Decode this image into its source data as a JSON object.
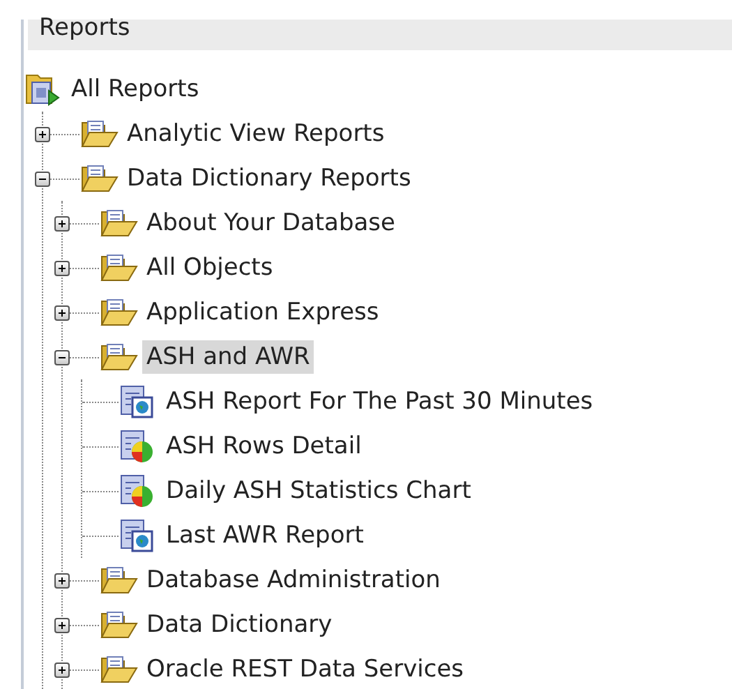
{
  "panel": {
    "title": "Reports"
  },
  "tree": [
    {
      "label": "All Reports",
      "kind": "root",
      "selected": false,
      "children": [
        {
          "label": "Analytic View Reports",
          "kind": "folder",
          "selected": false,
          "expanded": false
        },
        {
          "label": "Data Dictionary Reports",
          "kind": "folder",
          "selected": false,
          "expanded": true,
          "children": [
            {
              "label": "About Your Database",
              "kind": "folder",
              "selected": false,
              "expanded": false
            },
            {
              "label": "All Objects",
              "kind": "folder",
              "selected": false,
              "expanded": false
            },
            {
              "label": "Application Express",
              "kind": "folder",
              "selected": false,
              "expanded": false
            },
            {
              "label": "ASH and AWR",
              "kind": "folder",
              "selected": true,
              "expanded": true,
              "children": [
                {
                  "label": "ASH Report For The Past 30 Minutes",
                  "kind": "report",
                  "selected": false
                },
                {
                  "label": "ASH Rows Detail",
                  "kind": "chart",
                  "selected": false
                },
                {
                  "label": "Daily ASH Statistics Chart",
                  "kind": "chart",
                  "selected": false
                },
                {
                  "label": "Last AWR Report",
                  "kind": "report",
                  "selected": false
                }
              ]
            },
            {
              "label": "Database Administration",
              "kind": "folder",
              "selected": false,
              "expanded": false
            },
            {
              "label": "Data Dictionary",
              "kind": "folder",
              "selected": false,
              "expanded": false
            },
            {
              "label": "Oracle REST Data Services",
              "kind": "folder",
              "selected": false,
              "expanded": false
            }
          ]
        }
      ]
    }
  ]
}
